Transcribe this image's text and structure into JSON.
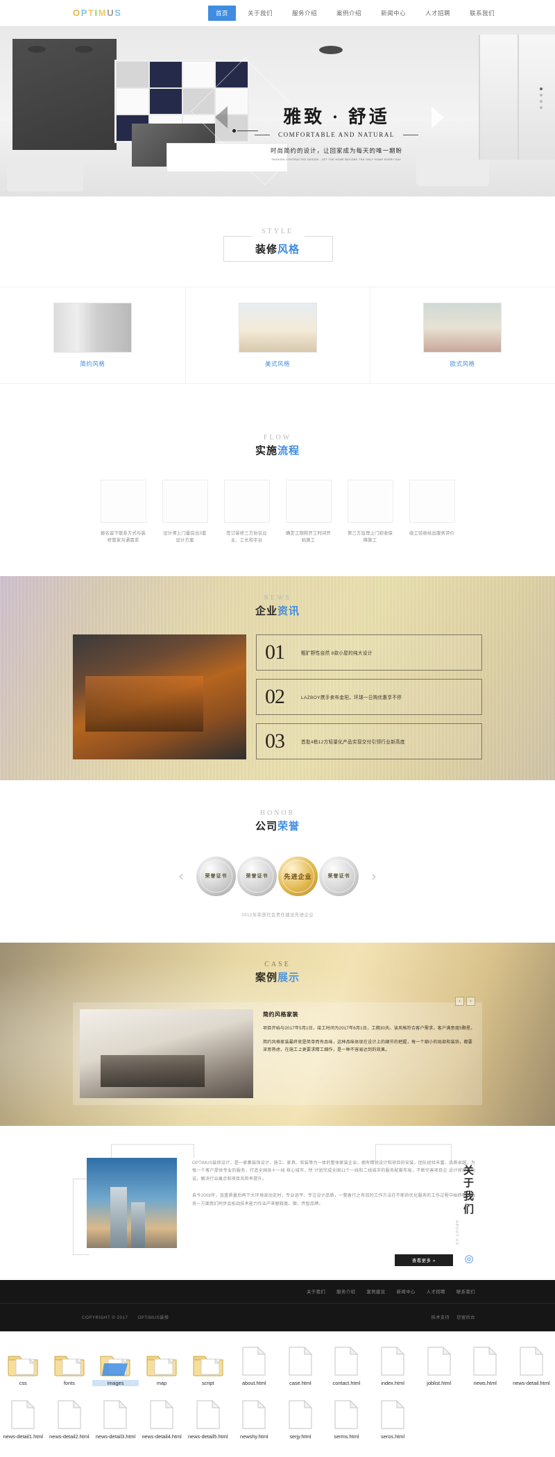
{
  "header": {
    "logo": "OPTIMUS",
    "nav": [
      {
        "label": "首页",
        "active": true
      },
      {
        "label": "关于我们",
        "active": false
      },
      {
        "label": "服务介绍",
        "active": false
      },
      {
        "label": "案例介绍",
        "active": false
      },
      {
        "label": "新闻中心",
        "active": false
      },
      {
        "label": "人才招聘",
        "active": false
      },
      {
        "label": "联系我们",
        "active": false
      }
    ]
  },
  "hero": {
    "title": "雅致 · 舒适",
    "subtitle": "COMFORTABLE AND NATURAL",
    "desc": "时尚简约的设计，让回家成为每天的唯一期盼",
    "desc_en": "FASHION CONTRACTED DESIGN , LET THE HOME BECOME THE ONLY HOME EVERY DAY"
  },
  "style": {
    "en": "STYLE",
    "cn_black": "装修",
    "cn_blue": "风格",
    "cards": [
      {
        "name": "简约风格"
      },
      {
        "name": "美式风格"
      },
      {
        "name": "欧式风格"
      }
    ]
  },
  "flow": {
    "en": "FLOW",
    "cn_black": "实施",
    "cn_blue": "流程",
    "steps": [
      {
        "icon": "monitor-phone-icon",
        "text": "报名留下联系方式与装修管家沟通需求"
      },
      {
        "icon": "ruler-pencil-icon",
        "text": "设计师上门量房出3套设计方案"
      },
      {
        "icon": "contract-card-icon",
        "text": "签订装修三方协议业主、工长和平台"
      },
      {
        "icon": "paint-roller-icon",
        "text": "确定工期和开工时间开始施工"
      },
      {
        "icon": "shield-worker-icon",
        "text": "第三方监理上门验收保障施工"
      },
      {
        "icon": "trophy-icon",
        "text": "竣工验收给出服务评价"
      }
    ]
  },
  "news": {
    "en": "NEWS",
    "cn_black": "企业",
    "cn_blue": "资讯",
    "items": [
      {
        "no": "01",
        "title": "粗犷野性自然 8款小屋的纯大设计"
      },
      {
        "no": "02",
        "title": "LAZBOY携手卖布金阳，环球一日购优惠享不停"
      },
      {
        "no": "03",
        "title": "首批4栋12方轻量化产品实现交付引领行业新高度"
      }
    ]
  },
  "honor": {
    "en": "HONOR",
    "cn_black": "公司",
    "cn_blue": "荣誉",
    "prev": "‹",
    "next": "›",
    "medals": [
      {
        "label": "荣誉证书"
      },
      {
        "label": "荣誉证书"
      },
      {
        "label": "先进企业"
      },
      {
        "label": "荣誉证书"
      }
    ],
    "caption": "2012年荣获社会责任建设先进企业"
  },
  "case": {
    "en": "CASE",
    "cn_black": "案例",
    "cn_blue": "展示",
    "title": "简约风格家装",
    "paragraphs": [
      "项目开始与2017年5月1日，竣工时间为2017年6月1日，工期30天。该风格符合客户需求，客户满意度5颗星。",
      "简约风格家装最终就是简单而有品味，这种品味体现在设计上的细节的把握，每一个细小的局部和装饰，都要深思熟虑，在施工上更要求精工细作，是一种不容易达到的效果。"
    ],
    "nav_prev": "‹",
    "nav_next": "›"
  },
  "about": {
    "cn": "关于\n我们",
    "cn_line1": "关",
    "cn_line2": "于",
    "cn_line3": "我",
    "cn_line4": "们",
    "en": "ABOUT US",
    "paragraphs": [
      "OPTIMUS装修设计，是一家集装饰设计、施工、家具、软装等为一体的整体家装企业，拥有精锐设计和项目的安装，团队经验丰富、品质卓越，为每一个客户提供专业的服务，打造全国各十一线 核心城市，所 计划完成全国11个一线和二线城市的服务配套布局，不断完善项目企 设计探索与创设，解决行业痛点和项目风险率提升。",
      "自今2008年，加重质量后再下大环境波动走时，专业运平、专注设计品质，一整备行之有效的工作方法在不断的优化服务的工作过程中始终融于服务一方面我们同步会拓战技术能力作业产来解释度、顺，传智品牌。"
    ],
    "button": "查看更多 »"
  },
  "footer": {
    "nav": [
      "关于我们",
      "服务介绍",
      "案例建设",
      "新闻中心",
      "人才招聘",
      "联系我们"
    ],
    "copyright": "COPYRIGHT © 2017",
    "company": "OPTIMUS装修",
    "right_links": [
      "技术支持",
      "您留后台"
    ]
  },
  "files": {
    "items": [
      {
        "name": "css",
        "type": "folder",
        "selected": false
      },
      {
        "name": "fonts",
        "type": "folder",
        "selected": false
      },
      {
        "name": "images",
        "type": "folder-open",
        "selected": true
      },
      {
        "name": "map",
        "type": "folder",
        "selected": false
      },
      {
        "name": "script",
        "type": "folder",
        "selected": false
      },
      {
        "name": "about.html",
        "type": "doc",
        "selected": false
      },
      {
        "name": "case.html",
        "type": "doc",
        "selected": false
      },
      {
        "name": "contact.html",
        "type": "doc",
        "selected": false
      },
      {
        "name": "index.html",
        "type": "doc",
        "selected": false
      },
      {
        "name": "joblist.html",
        "type": "doc",
        "selected": false
      },
      {
        "name": "news.html",
        "type": "doc",
        "selected": false
      },
      {
        "name": "news-detail.html",
        "type": "doc",
        "selected": false
      },
      {
        "name": "news-detail1.html",
        "type": "doc",
        "selected": false
      },
      {
        "name": "news-detail2.html",
        "type": "doc",
        "selected": false
      },
      {
        "name": "news-detail3.html",
        "type": "doc",
        "selected": false
      },
      {
        "name": "news-detail4.html",
        "type": "doc",
        "selected": false
      },
      {
        "name": "news-detail5.html",
        "type": "doc",
        "selected": false
      },
      {
        "name": "newshy.html",
        "type": "doc",
        "selected": false
      },
      {
        "name": "serjy.html",
        "type": "doc",
        "selected": false
      },
      {
        "name": "serms.html",
        "type": "doc",
        "selected": false
      },
      {
        "name": "seros.html",
        "type": "doc",
        "selected": false
      }
    ]
  },
  "colors": {
    "accent": "#3f8ce0",
    "dark": "#161616",
    "news_bg": "#e5d9ad"
  }
}
